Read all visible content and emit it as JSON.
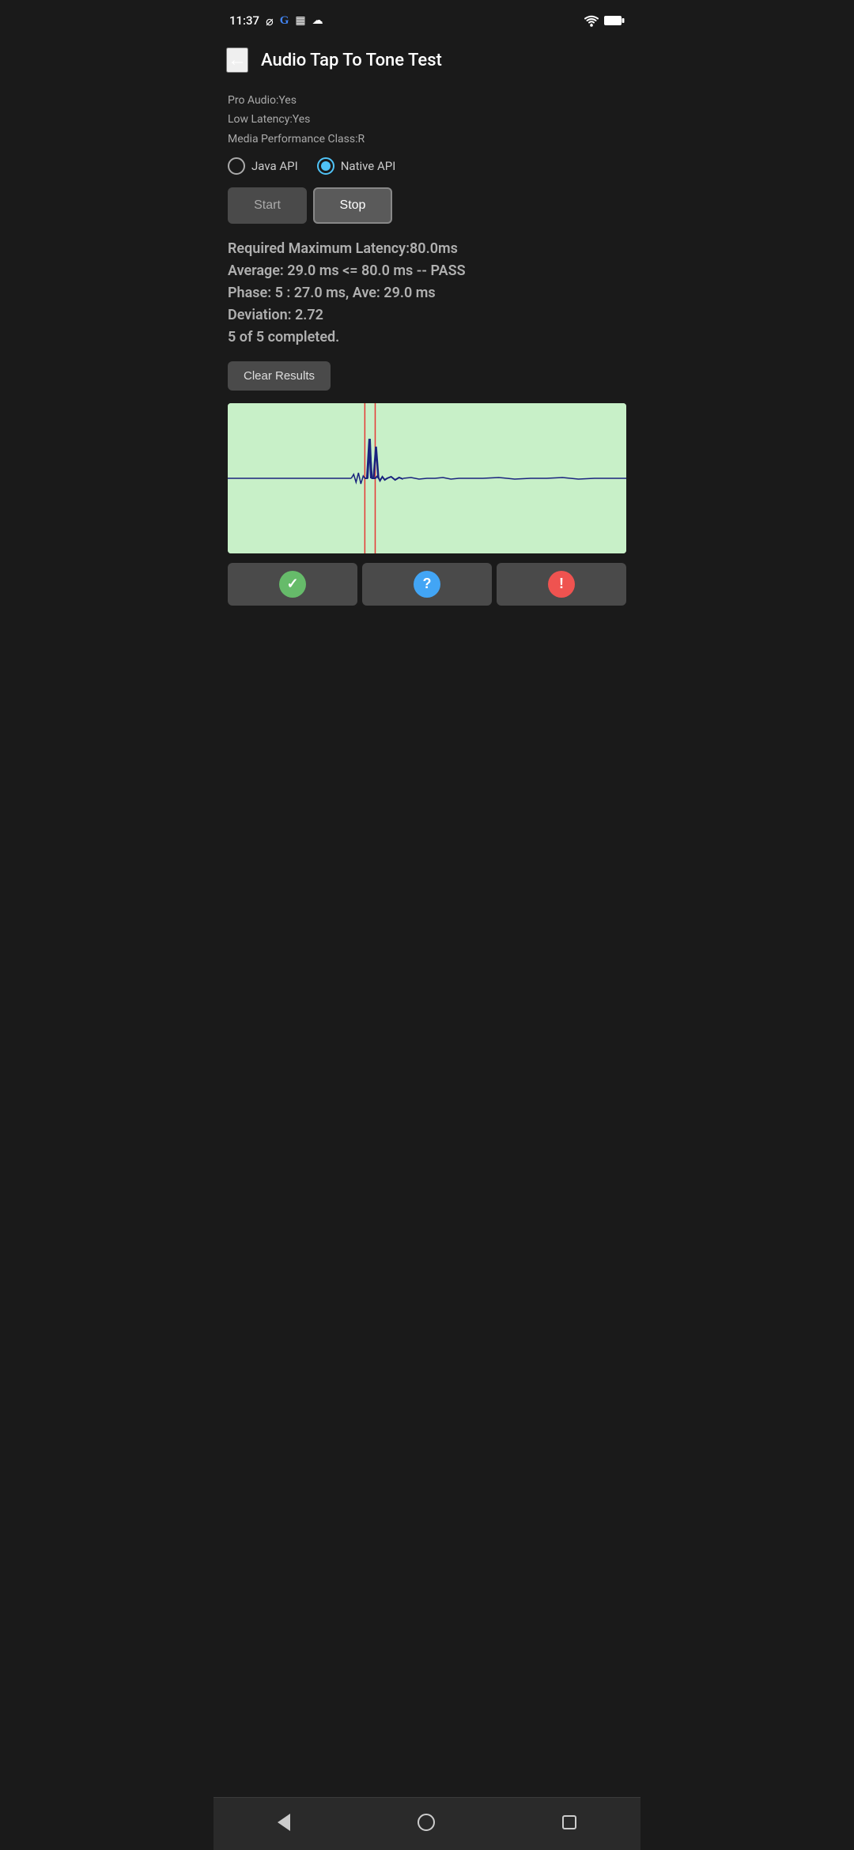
{
  "statusBar": {
    "time": "11:37",
    "icons": [
      "fan",
      "G",
      "calendar",
      "cloud"
    ]
  },
  "header": {
    "title": "Audio Tap To Tone Test",
    "backLabel": "←"
  },
  "deviceInfo": {
    "proAudio": "Pro Audio:Yes",
    "lowLatency": "Low Latency:Yes",
    "mediaPerformance": "Media Performance Class:R"
  },
  "apiSelector": {
    "javaLabel": "Java API",
    "nativeLabel": "Native API",
    "selected": "native"
  },
  "buttons": {
    "startLabel": "Start",
    "stopLabel": "Stop",
    "clearLabel": "Clear Results"
  },
  "results": {
    "line1": "Required Maximum Latency:80.0ms",
    "line2": "Average: 29.0 ms <= 80.0 ms -- PASS",
    "line3": "Phase: 5 : 27.0 ms, Ave: 29.0 ms",
    "line4": "Deviation: 2.72",
    "line5": "5 of 5 completed."
  },
  "waveform": {
    "bgColor": "#c8f0c8",
    "lineColor": "#1a237e",
    "markerColor": "#e53935"
  },
  "bottomIcons": {
    "checkLabel": "✓",
    "questionLabel": "?",
    "warningLabel": "!"
  },
  "navBar": {
    "backBtn": "back",
    "homeBtn": "home",
    "recentBtn": "recent"
  }
}
